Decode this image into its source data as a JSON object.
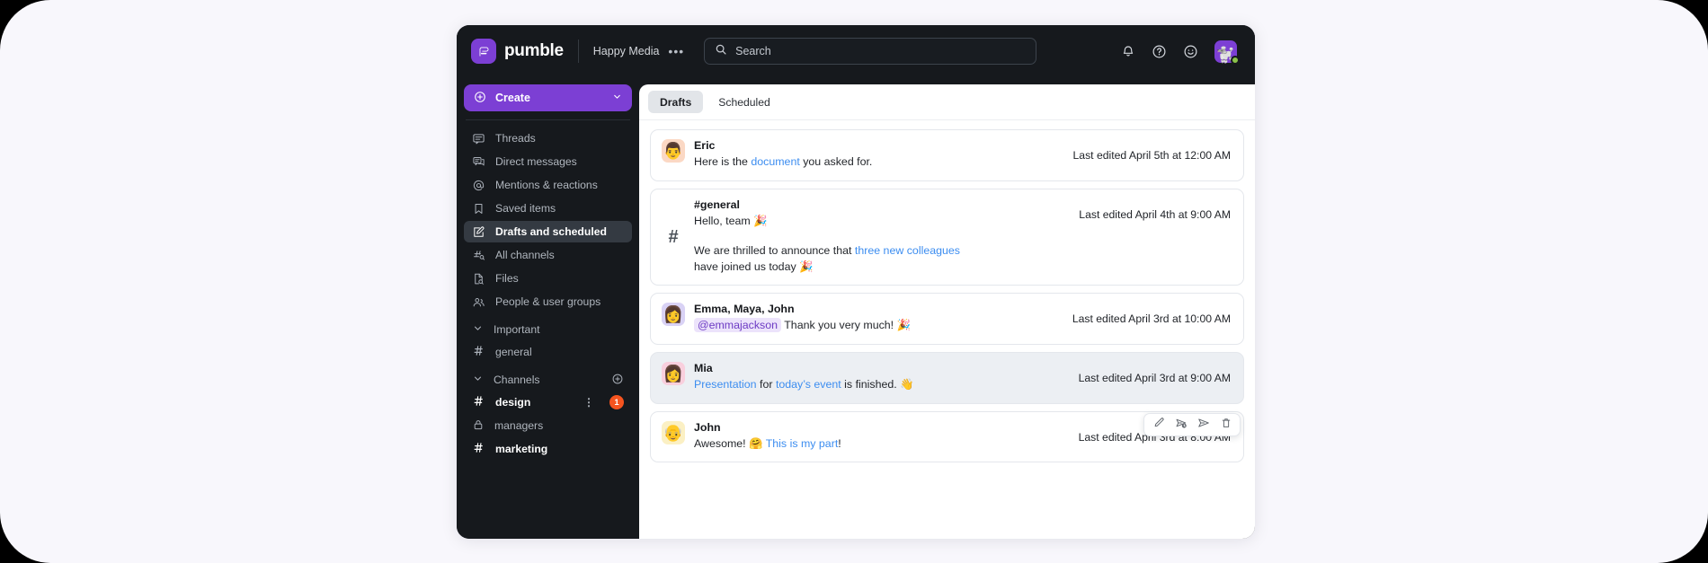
{
  "topbar": {
    "brand_name": "pumble",
    "brand_icon": "pumble-logo-icon",
    "workspace": "Happy Media",
    "workspace_more": "•••",
    "search_placeholder": "Search",
    "search_value": "",
    "icons": {
      "search": "search-icon",
      "notifications": "bell-icon",
      "help": "question-circle-icon",
      "emoji": "smiley-icon",
      "avatar": "user-avatar"
    },
    "avatar_emoji": "🐩",
    "status": "online"
  },
  "sidebar": {
    "create_label": "Create",
    "nav": [
      {
        "label": "Threads",
        "icon": "threads-icon",
        "active": false
      },
      {
        "label": "Direct messages",
        "icon": "direct-messages-icon",
        "active": false
      },
      {
        "label": "Mentions & reactions",
        "icon": "at-icon",
        "active": false
      },
      {
        "label": "Saved items",
        "icon": "bookmark-icon",
        "active": false
      },
      {
        "label": "Drafts and scheduled",
        "icon": "draft-pencil-icon",
        "active": true
      },
      {
        "label": "All channels",
        "icon": "all-channels-icon",
        "active": false
      },
      {
        "label": "Files",
        "icon": "file-search-icon",
        "active": false
      },
      {
        "label": "People & user groups",
        "icon": "people-icon",
        "active": false
      }
    ],
    "sections": [
      {
        "label": "Important",
        "collapse_icon": "chevron-down-icon",
        "has_add": false,
        "channels": [
          {
            "name": "general",
            "icon": "hash-icon",
            "unread": false,
            "badge": ""
          }
        ]
      },
      {
        "label": "Channels",
        "collapse_icon": "chevron-down-icon",
        "has_add": true,
        "add_icon": "plus-circle-icon",
        "channels": [
          {
            "name": "design",
            "icon": "hash-icon",
            "unread": true,
            "badge": "1",
            "kebab": "⋮"
          },
          {
            "name": "managers",
            "icon": "lock-icon",
            "unread": false,
            "badge": ""
          },
          {
            "name": "marketing",
            "icon": "hash-icon",
            "unread": true,
            "badge": ""
          }
        ]
      }
    ]
  },
  "main": {
    "tabs": [
      {
        "label": "Drafts",
        "active": true
      },
      {
        "label": "Scheduled",
        "active": false
      }
    ],
    "cards": [
      {
        "kind": "dm",
        "avatar_emoji": "👨",
        "avatar_bg": "#fbd8c4",
        "title": "Eric",
        "time": "Last edited April 5th at 12:00 AM",
        "highlight": false,
        "lines": [
          {
            "parts": [
              {
                "t": "Here is the ",
                "style": "plain"
              },
              {
                "t": "document",
                "style": "link"
              },
              {
                "t": " you asked for.",
                "style": "plain"
              }
            ]
          }
        ]
      },
      {
        "kind": "channel",
        "hash": "#",
        "title": "#general",
        "time": "Last edited April 4th at 9:00 AM",
        "highlight": false,
        "lines": [
          {
            "parts": [
              {
                "t": "Hello, team 🎉",
                "style": "plain"
              }
            ]
          },
          {
            "spaced": true,
            "parts": [
              {
                "t": "We are thrilled to announce that ",
                "style": "plain"
              },
              {
                "t": "three new colleagues",
                "style": "link"
              },
              {
                "t": " have joined us today 🎉",
                "style": "plain"
              }
            ]
          }
        ]
      },
      {
        "kind": "group",
        "avatar_emoji": "👩",
        "avatar_bg": "#d9d2f5",
        "title": "Emma, Maya, John",
        "time": "Last edited April 3rd at 10:00 AM",
        "highlight": false,
        "lines": [
          {
            "parts": [
              {
                "t": "@emmajackson",
                "style": "mention"
              },
              {
                "t": " Thank you very much! 🎉",
                "style": "plain"
              }
            ]
          }
        ]
      },
      {
        "kind": "dm",
        "avatar_emoji": "👩",
        "avatar_bg": "#f9cfdd",
        "title": "Mia",
        "time": "Last edited April 3rd at 9:00 AM",
        "highlight": true,
        "lines": [
          {
            "parts": [
              {
                "t": "Presentation",
                "style": "link"
              },
              {
                "t": " for ",
                "style": "plain"
              },
              {
                "t": "today’s event",
                "style": "link"
              },
              {
                "t": " is finished. 👋",
                "style": "plain"
              }
            ]
          }
        ]
      },
      {
        "kind": "dm",
        "avatar_emoji": "👴",
        "avatar_bg": "#fbf0c4",
        "title": "John",
        "time": "Last edited April 3rd at 8:00 AM",
        "highlight": false,
        "lines": [
          {
            "parts": [
              {
                "t": "Awesome! 🤗 ",
                "style": "plain"
              },
              {
                "t": "This is my part",
                "style": "link"
              },
              {
                "t": "!",
                "style": "plain"
              }
            ]
          }
        ]
      }
    ],
    "hover_toolbar": [
      {
        "name": "edit-draft-button",
        "icon": "pencil-icon"
      },
      {
        "name": "schedule-send-button",
        "icon": "schedule-send-icon"
      },
      {
        "name": "send-now-button",
        "icon": "send-icon"
      },
      {
        "name": "delete-draft-button",
        "icon": "trash-icon"
      }
    ]
  },
  "colors": {
    "brand_purple": "#7c3fd4",
    "badge_orange": "#f6541f",
    "link_blue": "#3c8df0",
    "mention_bg": "#ece3fb",
    "dark_bg": "#16191d",
    "page_bg": "#f8f7fc",
    "status_green": "#8bc34a"
  }
}
